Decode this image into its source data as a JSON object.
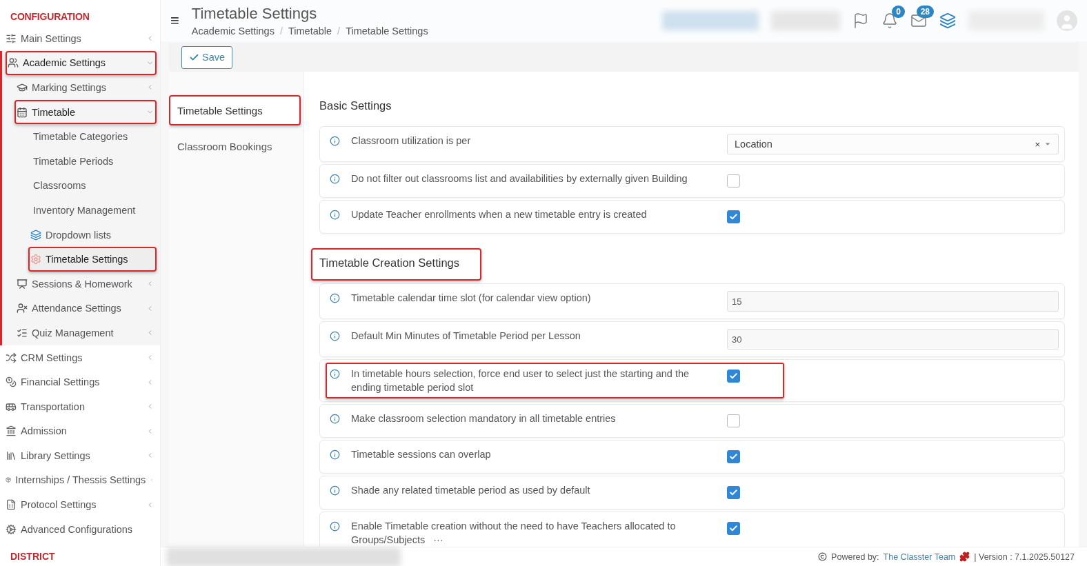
{
  "sidebar": {
    "heading": "CONFIGURATION",
    "items": [
      {
        "label": "Main Settings",
        "expanded": false,
        "highlighted": false
      },
      {
        "label": "Academic Settings",
        "expanded": true,
        "highlighted": true,
        "children": [
          {
            "label": "Marking Settings",
            "expanded": false,
            "highlighted": false
          },
          {
            "label": "Timetable",
            "expanded": true,
            "highlighted": true,
            "children": [
              {
                "label": "Timetable Categories",
                "highlighted": false,
                "selected": false
              },
              {
                "label": "Timetable Periods",
                "highlighted": false,
                "selected": false
              },
              {
                "label": "Classrooms",
                "highlighted": false,
                "selected": false
              },
              {
                "label": "Inventory Management",
                "highlighted": false,
                "selected": false
              },
              {
                "label": "Dropdown lists",
                "highlighted": false,
                "selected": false
              },
              {
                "label": "Timetable Settings",
                "highlighted": true,
                "selected": true
              }
            ]
          },
          {
            "label": "Sessions & Homework",
            "expanded": false,
            "highlighted": false
          },
          {
            "label": "Attendance Settings",
            "expanded": false,
            "highlighted": false
          },
          {
            "label": "Quiz Management",
            "expanded": false,
            "highlighted": false
          }
        ]
      },
      {
        "label": "CRM Settings",
        "expanded": false,
        "highlighted": false
      },
      {
        "label": "Financial Settings",
        "expanded": false,
        "highlighted": false
      },
      {
        "label": "Transportation",
        "expanded": false,
        "highlighted": false
      },
      {
        "label": "Admission",
        "expanded": false,
        "highlighted": false
      },
      {
        "label": "Library Settings",
        "expanded": false,
        "highlighted": false
      },
      {
        "label": "Internships / Thessis Settings",
        "expanded": false,
        "highlighted": false
      },
      {
        "label": "Protocol Settings",
        "expanded": false,
        "highlighted": false
      },
      {
        "label": "Advanced Configurations",
        "highlighted": false
      }
    ],
    "footer_heading": "DISTRICT"
  },
  "header": {
    "menu_glyph": "≡",
    "title": "Timetable Settings",
    "breadcrumbs": [
      "Academic Settings",
      "Timetable",
      "Timetable Settings"
    ],
    "separator": "/",
    "bell_badge": "0",
    "mail_badge": "28"
  },
  "toolbar": {
    "save_label": "Save"
  },
  "tabs": [
    {
      "label": "Timetable Settings",
      "selected": true,
      "highlighted": true
    },
    {
      "label": "Classroom Bookings",
      "selected": false,
      "highlighted": false
    }
  ],
  "sections": [
    {
      "title": "Basic Settings",
      "highlighted": false,
      "rows": [
        {
          "kind": "select",
          "label": "Classroom utilization is per",
          "value": "Location",
          "clear": "×",
          "highlighted": false
        },
        {
          "kind": "checkbox",
          "label": "Do not filter out classrooms list and availabilities by externally given Building",
          "checked": false,
          "highlighted": false
        },
        {
          "kind": "checkbox",
          "label": "Update Teacher enrollments when a new timetable entry is created",
          "checked": true,
          "highlighted": false
        }
      ]
    },
    {
      "title": "Timetable Creation Settings",
      "highlighted": true,
      "rows": [
        {
          "kind": "number",
          "label": "Timetable calendar time slot (for calendar view option)",
          "value": "15",
          "highlighted": false
        },
        {
          "kind": "number",
          "label": "Default Min Minutes of Timetable Period per Lesson",
          "value": "30",
          "highlighted": false
        },
        {
          "kind": "checkbox",
          "label": "In timetable hours selection, force end user to select just the starting and the ending timetable period slot",
          "checked": true,
          "highlighted": true
        },
        {
          "kind": "checkbox",
          "label": "Make classroom selection mandatory in all timetable entries",
          "checked": false,
          "highlighted": false
        },
        {
          "kind": "checkbox",
          "label": "Timetable sessions can overlap",
          "checked": true,
          "highlighted": false
        },
        {
          "kind": "checkbox",
          "label": "Shade any related timetable period as used by default",
          "checked": true,
          "highlighted": false
        },
        {
          "kind": "checkbox",
          "label": "Enable Timetable creation without the need to have Teachers allocated to Groups/Subjects",
          "more": "···",
          "checked": true,
          "highlighted": false
        }
      ]
    }
  ],
  "footer": {
    "powered": "Powered by:",
    "team": "The Classter Team",
    "version": "| Version : 7.1.2025.50127"
  }
}
